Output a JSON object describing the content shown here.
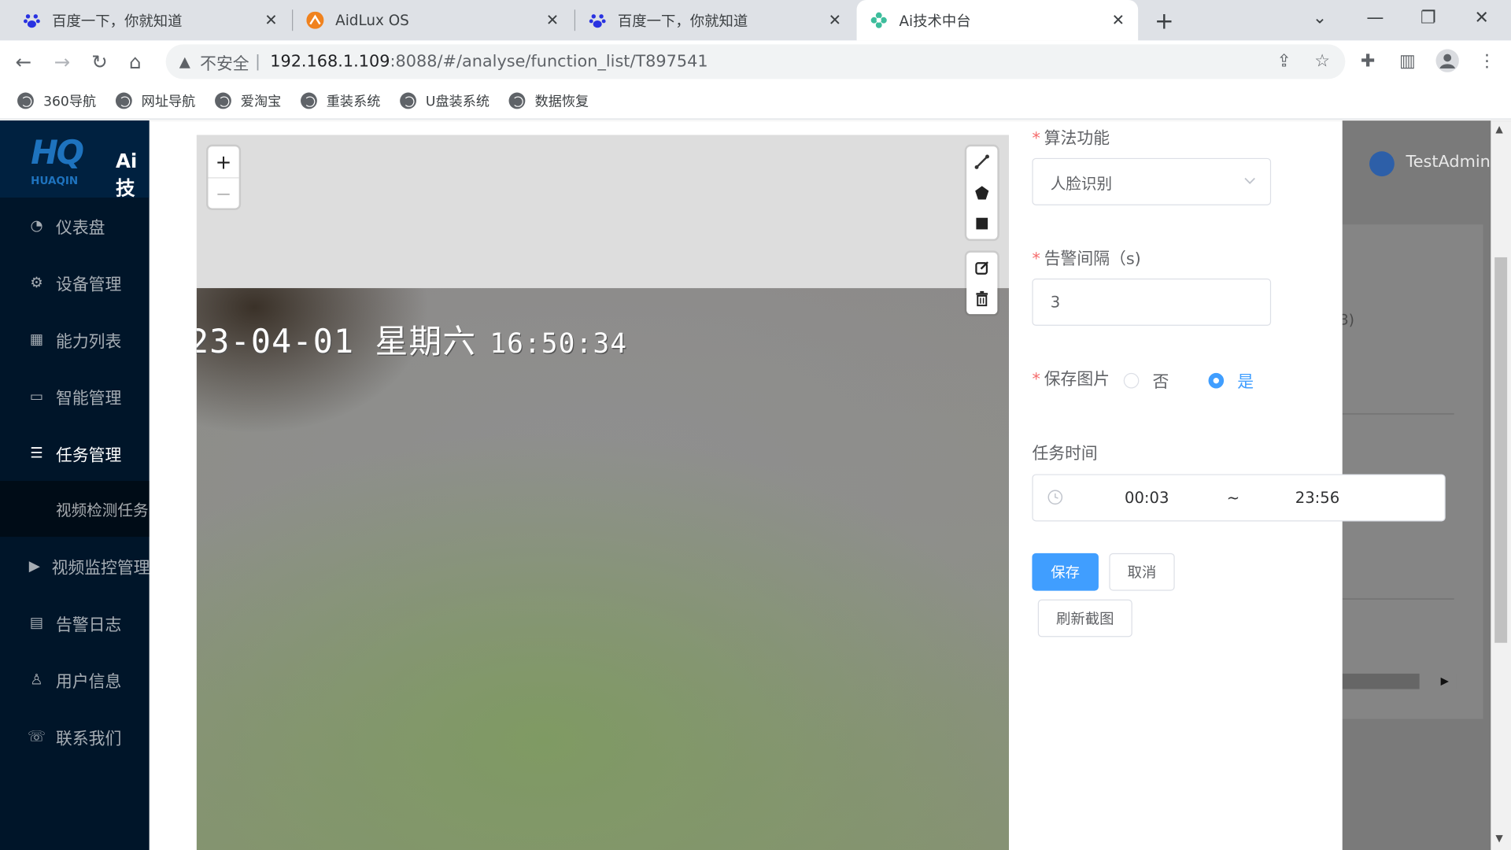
{
  "browser": {
    "tabs": [
      {
        "title": "百度一下，你就知道",
        "icon": "baidu-paw-icon"
      },
      {
        "title": "AidLux OS",
        "icon": "aidlux-icon"
      },
      {
        "title": "百度一下，你就知道",
        "icon": "baidu-paw-icon"
      },
      {
        "title": "Ai技术中台",
        "icon": "gear-flower-icon",
        "active": true
      }
    ],
    "address": {
      "insecure_label": "不安全",
      "host": "192.168.1.109",
      "rest": ":8088/#/analyse/function_list/T897541"
    },
    "bookmarks": [
      "360导航",
      "网址导航",
      "爱淘宝",
      "重装系统",
      "U盘装系统",
      "数据恢复"
    ]
  },
  "app": {
    "logo_text": "HQ",
    "logo_sub": "HUAQIN",
    "logo_title": "Ai技",
    "user": "TestAdmin",
    "menu": [
      {
        "label": "仪表盘",
        "icon": "dashboard-icon"
      },
      {
        "label": "设备管理",
        "icon": "gear-icon"
      },
      {
        "label": "能力列表",
        "icon": "chart-icon"
      },
      {
        "label": "智能管理",
        "icon": "monitor-icon"
      },
      {
        "label": "任务管理",
        "icon": "list-icon"
      },
      {
        "label": "视频监控管理",
        "icon": "video-icon"
      },
      {
        "label": "告警日志",
        "icon": "calendar-icon"
      },
      {
        "label": "用户信息",
        "icon": "user-icon"
      },
      {
        "label": "联系我们",
        "icon": "contact-icon"
      }
    ],
    "submenu_item": "视频检测任务",
    "bg_paren": "3)"
  },
  "dialog": {
    "map": {
      "osd_date": "23-04-01 星期六",
      "osd_time": "16:50:34",
      "zoom_in": "+",
      "zoom_out": "−"
    },
    "form": {
      "algorithm_label": "算法功能",
      "algorithm_value": "人脸识别",
      "interval_label": "告警间隔（s)",
      "interval_value": "3",
      "save_image_label": "保存图片",
      "save_image_options": [
        "否",
        "是"
      ],
      "save_image_selected": "是",
      "task_time_label": "任务时间",
      "time_start": "00:03",
      "time_separator": "~",
      "time_end": "23:56",
      "save_button": "保存",
      "cancel_button": "取消",
      "refresh_button": "刷新截图"
    }
  },
  "colors": {
    "primary": "#409eff",
    "sidebar": "#001529",
    "required": "#f56c6c"
  }
}
